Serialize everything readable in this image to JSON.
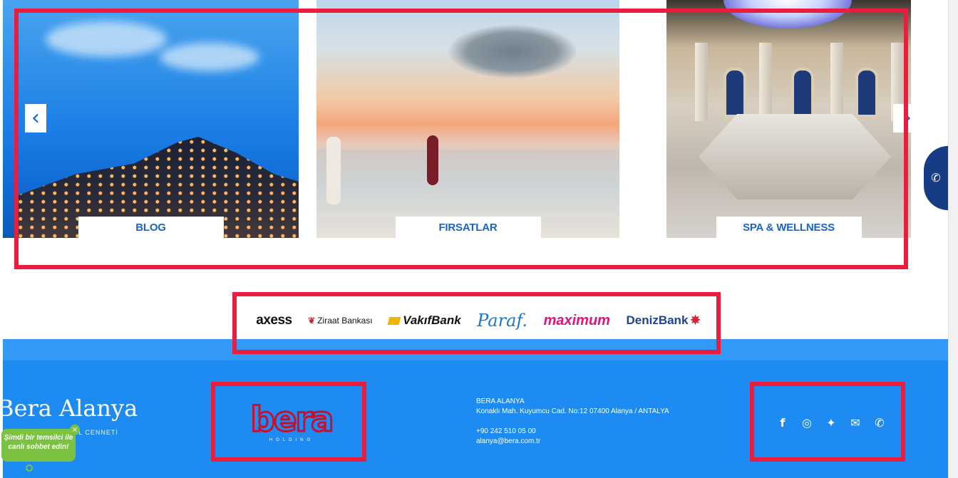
{
  "carousel": {
    "cards": [
      {
        "label": "BLOG"
      },
      {
        "label": "FIRSATLAR"
      },
      {
        "label": "SPA & WELLNESS"
      }
    ],
    "prev_icon": "chevron-left-icon",
    "next_icon": "chevron-right-icon"
  },
  "banks": {
    "axess": "axess",
    "ziraat": "Ziraat Bankası",
    "vakifbank": "VakıfBank",
    "paraf": "Paraf.",
    "maximum": "maximum",
    "denizbank": "DenizBank"
  },
  "footer": {
    "logo_text": "Bera Alanya",
    "logo_sub": "TATİL CENNETİ",
    "holding_word": "bera",
    "holding_sub": "HOLDING",
    "address": {
      "name": "BERA ALANYA",
      "line": "Konaklı Mah. Kuyumcu Cad. No:12 07400 Alanya / ANTALYA",
      "phone": "+90 242 510 05 00",
      "email": "alanya@bera.com.tr"
    },
    "social": [
      "facebook-icon",
      "instagram-icon",
      "twitter-icon",
      "mail-icon",
      "whatsapp-icon"
    ]
  },
  "chat": {
    "line1": "Şimdi bir temsilci ile",
    "line2": "canlı sohbet edin!"
  },
  "colors": {
    "accent_blue": "#1b63c6",
    "footer_blue": "#1e8bf3",
    "annotation_red": "#ea1d3e",
    "chat_green": "#7cc242"
  }
}
